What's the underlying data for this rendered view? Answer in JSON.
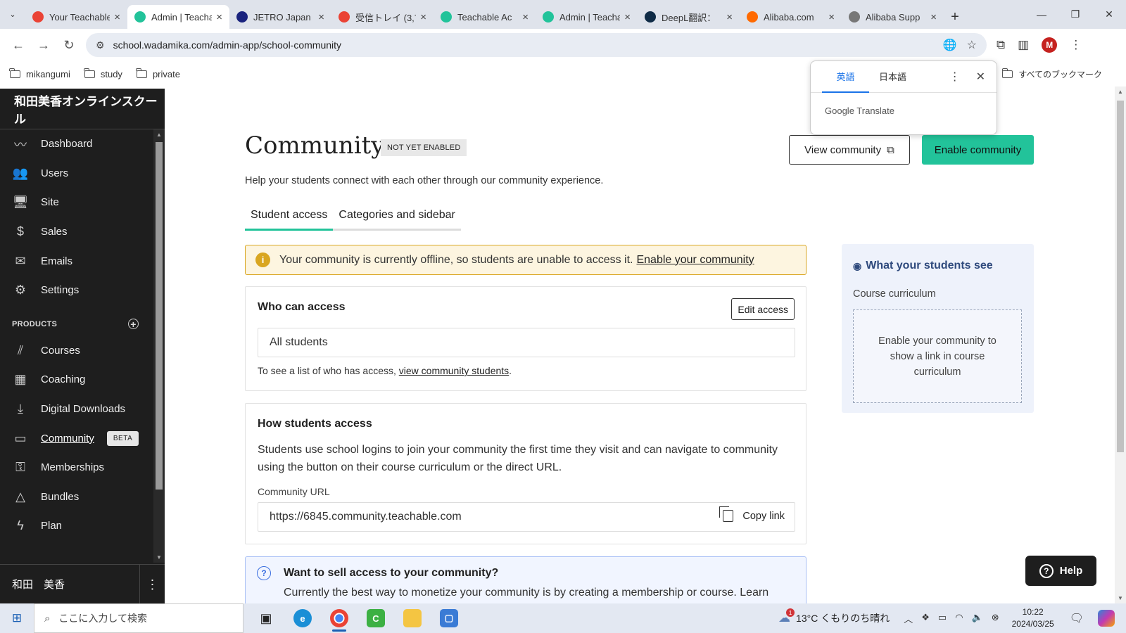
{
  "browser": {
    "tabs": [
      {
        "title": "Your Teachable",
        "favicon": "gmail-icon",
        "color": "#ea4335",
        "active": false
      },
      {
        "title": "Admin | Teachable",
        "favicon": "teachable-icon",
        "color": "#22c39a",
        "active": true
      },
      {
        "title": "JETRO Japan",
        "favicon": "jetro-icon",
        "color": "#1a237e",
        "active": false
      },
      {
        "title": "受信トレイ (3,7",
        "favicon": "gmail-icon",
        "color": "#ea4335",
        "active": false
      },
      {
        "title": "Teachable Ac",
        "favicon": "teachable-icon",
        "color": "#22c39a",
        "active": false
      },
      {
        "title": "Admin | Teachable",
        "favicon": "teachable-icon",
        "color": "#22c39a",
        "active": false
      },
      {
        "title": "DeepL翻訳：",
        "favicon": "deepl-icon",
        "color": "#0f2b46",
        "active": false
      },
      {
        "title": "Alibaba.com",
        "favicon": "alibaba-icon",
        "color": "#ff6a00",
        "active": false
      },
      {
        "title": "Alibaba Supp",
        "favicon": "globe-icon",
        "color": "#777777",
        "active": false
      }
    ],
    "url": "school.wadamika.com/admin-app/school-community",
    "profile_initial": "M",
    "bookmarks": [
      "mikangumi",
      "study",
      "private"
    ],
    "all_bookmarks": "すべてのブックマーク"
  },
  "translate_popup": {
    "lang_source": "英語",
    "lang_target": "日本語",
    "brand": "Google Translate"
  },
  "sidebar": {
    "school_name": "和田美香オンラインスクール",
    "items": [
      {
        "label": "Dashboard",
        "icon": "chart-line-icon",
        "glyph": "〰"
      },
      {
        "label": "Users",
        "icon": "users-icon",
        "glyph": "👥"
      },
      {
        "label": "Site",
        "icon": "devices-icon",
        "glyph": "🖥"
      },
      {
        "label": "Sales",
        "icon": "dollar-icon",
        "glyph": "$"
      },
      {
        "label": "Emails",
        "icon": "mail-icon",
        "glyph": "✉"
      },
      {
        "label": "Settings",
        "icon": "gear-icon",
        "glyph": "⚙"
      }
    ],
    "products_header": "PRODUCTS",
    "products": [
      {
        "label": "Courses",
        "icon": "library-icon",
        "glyph": "⫽"
      },
      {
        "label": "Coaching",
        "icon": "calendar-icon",
        "glyph": "▦"
      },
      {
        "label": "Digital Downloads",
        "icon": "download-file-icon",
        "glyph": "⤓"
      },
      {
        "label": "Community",
        "icon": "chat-icon",
        "glyph": "▭",
        "active": true,
        "badge": "BETA"
      },
      {
        "label": "Memberships",
        "icon": "key-icon",
        "glyph": "⚿"
      },
      {
        "label": "Bundles",
        "icon": "shapes-icon",
        "glyph": "△"
      },
      {
        "label": "Plan",
        "icon": "bolt-icon",
        "glyph": "ϟ"
      }
    ],
    "user_name": "和田　美香"
  },
  "page": {
    "title": "Community",
    "status": "NOT YET ENABLED",
    "view_button": "View community",
    "enable_button": "Enable community",
    "subtitle": "Help your students connect with each other through our community experience.",
    "tabs": [
      "Student access",
      "Categories and sidebar"
    ],
    "alert": {
      "text": "Your community is currently offline, so students are unable to access it.",
      "link": "Enable your community"
    },
    "who_can_access": {
      "heading": "Who can access",
      "edit_button": "Edit access",
      "value": "All students",
      "hint": "To see a list of who has access,",
      "hint_link": "view community students",
      "hint_end": "."
    },
    "how_access": {
      "heading": "How students access",
      "description": "Students use school logins to join your community the first time they visit and can navigate to community using the button on their course curriculum or the direct URL.",
      "url_label": "Community URL",
      "url": "https://6845.community.teachable.com",
      "copy_button": "Copy link"
    },
    "sell": {
      "heading": "Want to sell access to your community?",
      "body": "Currently the best way to monetize your community is by creating a membership or course. Learn"
    },
    "preview": {
      "heading": "What your students see",
      "label": "Course curriculum",
      "placeholder": "Enable your community to show a link in course curriculum"
    },
    "help_button": "Help"
  },
  "taskbar": {
    "search_placeholder": "ここに入力して検索",
    "weather": "13°C くもりのち晴れ",
    "weather_badge": "1",
    "time": "10:22",
    "date": "2024/03/25"
  },
  "colors": {
    "accent": "#22c39a",
    "alert_border": "#d9a621",
    "sidebar_bg": "#1e1e1e"
  }
}
